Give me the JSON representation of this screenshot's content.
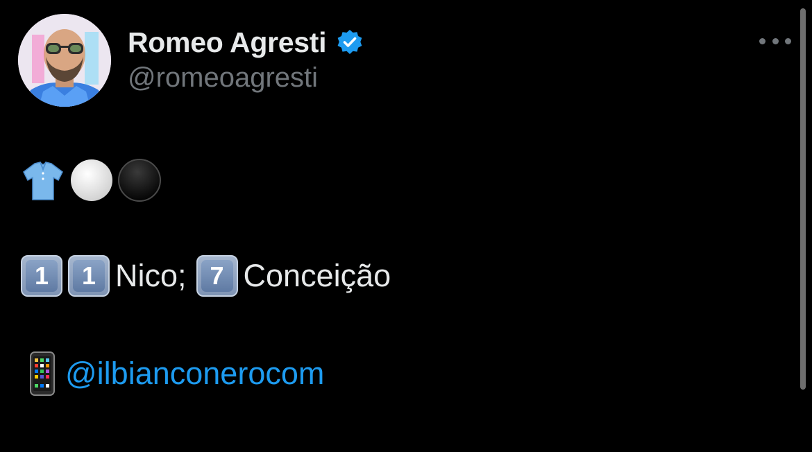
{
  "tweet": {
    "author": {
      "display_name": "Romeo Agresti",
      "handle": "@romeoagresti",
      "verified_icon": "verified-badge-icon"
    },
    "menu_icon": "more-options-icon",
    "lines": [
      {
        "emojis": [
          "shirt-icon",
          "white-circle-icon",
          "black-circle-icon"
        ]
      },
      {
        "keycap_1a": "1",
        "keycap_1b": "1",
        "text_1": "Nico;",
        "keycap_2": "7",
        "text_2": "Conceição"
      },
      {
        "emoji": "mobile-phone-icon",
        "mention": "@ilbianconerocom"
      }
    ]
  },
  "colors": {
    "background": "#000000",
    "primary_text": "#e7e9ea",
    "secondary_text": "#71767b",
    "link": "#1d9bf0",
    "verified": "#1d9bf0"
  }
}
